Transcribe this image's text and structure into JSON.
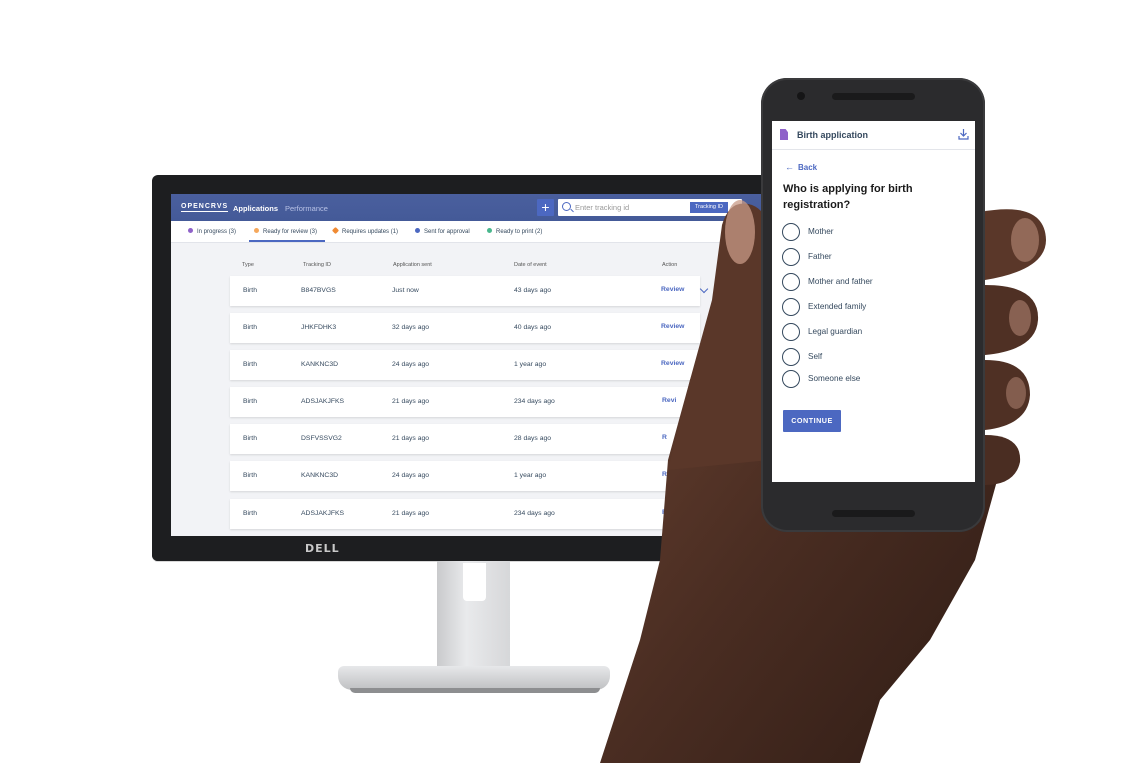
{
  "desktop": {
    "logo": "OPENCRVS",
    "nav": {
      "applications": "Applications",
      "performance": "Performance"
    },
    "plus": "+",
    "search": {
      "placeholder": "Enter tracking id",
      "tag": "Tracking ID"
    },
    "statuses": [
      {
        "label": "In progress (3)",
        "color": "#8f62c9"
      },
      {
        "label": "Ready for review (3)",
        "color": "#f5a85c"
      },
      {
        "label": "Requires updates (1)",
        "color": "#f08a32"
      },
      {
        "label": "Sent for approval",
        "color": "#4c68c1"
      },
      {
        "label": "Ready to print (2)",
        "color": "#49b78d"
      }
    ],
    "columns": [
      "Type",
      "Tracking ID",
      "Application sent",
      "Date of event",
      "Action"
    ],
    "rows": [
      {
        "type": "Birth",
        "tracking_id": "B847BVGS",
        "sent": "Just now",
        "event": "43 days ago",
        "action": "Review"
      },
      {
        "type": "Birth",
        "tracking_id": "JHKFDHK3",
        "sent": "32 days ago",
        "event": "40 days ago",
        "action": "Review"
      },
      {
        "type": "Birth",
        "tracking_id": "KANKNC3D",
        "sent": "24 days ago",
        "event": "1 year ago",
        "action": "Review"
      },
      {
        "type": "Birth",
        "tracking_id": "ADSJAKJFKS",
        "sent": "21 days ago",
        "event": "234 days ago",
        "action": "Revi"
      },
      {
        "type": "Birth",
        "tracking_id": "DSFVSSVG2",
        "sent": "21 days ago",
        "event": "28 days ago",
        "action": "R"
      },
      {
        "type": "Birth",
        "tracking_id": "KANKNC3D",
        "sent": "24 days ago",
        "event": "1 year ago",
        "action": "R"
      },
      {
        "type": "Birth",
        "tracking_id": "ADSJAKJFKS",
        "sent": "21 days ago",
        "event": "234 days ago",
        "action": "R"
      }
    ],
    "brand": "DELL"
  },
  "phone": {
    "title": "Birth application",
    "back": "Back",
    "question": "Who is applying for birth registration?",
    "options": [
      "Mother",
      "Father",
      "Mother and father",
      "Extended family",
      "Legal guardian",
      "Self",
      "Someone else"
    ],
    "continue": "CONTINUE"
  },
  "colors": {
    "primary": "#4c68c1",
    "topbar": "#4a5f9e",
    "text": "#35495e",
    "skin": "#4a2e22"
  }
}
